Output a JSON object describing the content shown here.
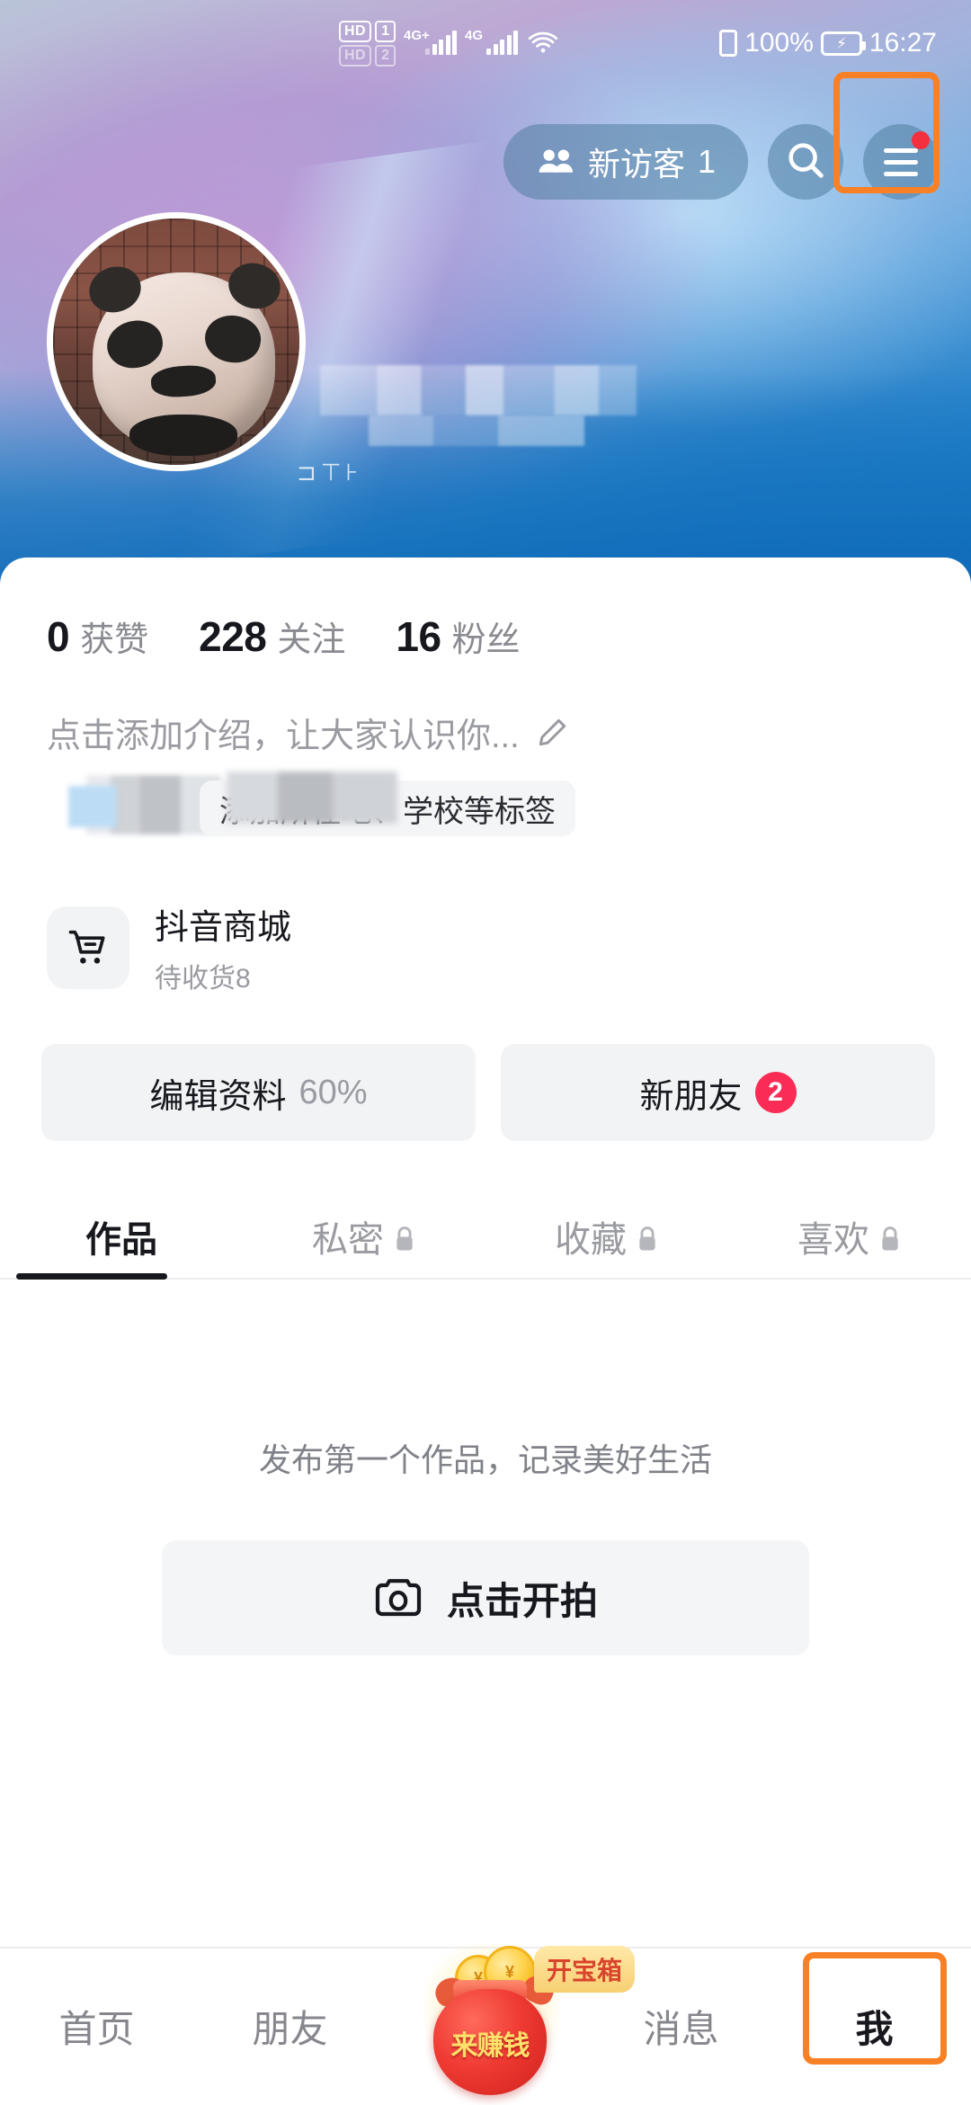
{
  "status_bar": {
    "hd1_label": "HD",
    "sim1": "1",
    "hd2_label": "HD",
    "sim2": "2",
    "net1": "4G+",
    "net2": "4G",
    "wifi_icon": "wifi-icon",
    "vibrate_icon": "vibrate-icon",
    "battery_percent": "100%",
    "battery_icon": "battery-charging-icon",
    "time": "16:27"
  },
  "topbar": {
    "visitor_label": "新访客",
    "visitor_count": "1",
    "people_icon": "people-icon",
    "search_icon": "search-icon",
    "menu_icon": "hamburger-menu-icon",
    "menu_has_dot": true,
    "highlight_color": "#F98024"
  },
  "profile": {
    "avatar_icon": "user-avatar",
    "display_name_blurred": true,
    "id_fragment": "⊐⊤⊦"
  },
  "stats": [
    {
      "num": "0",
      "label": "获赞"
    },
    {
      "num": "228",
      "label": "关注"
    },
    {
      "num": "16",
      "label": "粉丝"
    }
  ],
  "bio": {
    "placeholder": "点击添加介绍，让大家认识你...",
    "edit_icon": "pencil-icon"
  },
  "tags": {
    "add_tag_label": "添加所在地、学校等标签",
    "blurred": true
  },
  "mall": {
    "icon": "shopping-cart-icon",
    "title": "抖音商城",
    "subtitle": "待收货8"
  },
  "actions": {
    "edit_profile_label": "编辑资料",
    "edit_profile_progress": "60%",
    "new_friends_label": "新朋友",
    "new_friends_badge": "2",
    "badge_color": "#fa2c56"
  },
  "tabs": [
    {
      "label": "作品",
      "locked": false,
      "active": true
    },
    {
      "label": "私密",
      "locked": true,
      "active": false
    },
    {
      "label": "收藏",
      "locked": true,
      "active": false
    },
    {
      "label": "喜欢",
      "locked": true,
      "active": false
    }
  ],
  "empty_state": {
    "message": "发布第一个作品，记录美好生活",
    "button_label": "点击开拍",
    "button_icon": "camera-icon"
  },
  "bottom_nav": {
    "items": [
      {
        "label": "首页",
        "active": false
      },
      {
        "label": "朋友",
        "active": false
      },
      {
        "label": "我",
        "active": true
      }
    ],
    "messages_label": "消息",
    "money": {
      "bag_label": "来赚钱",
      "tooltip": "开宝箱",
      "icon": "money-bag-icon"
    }
  }
}
